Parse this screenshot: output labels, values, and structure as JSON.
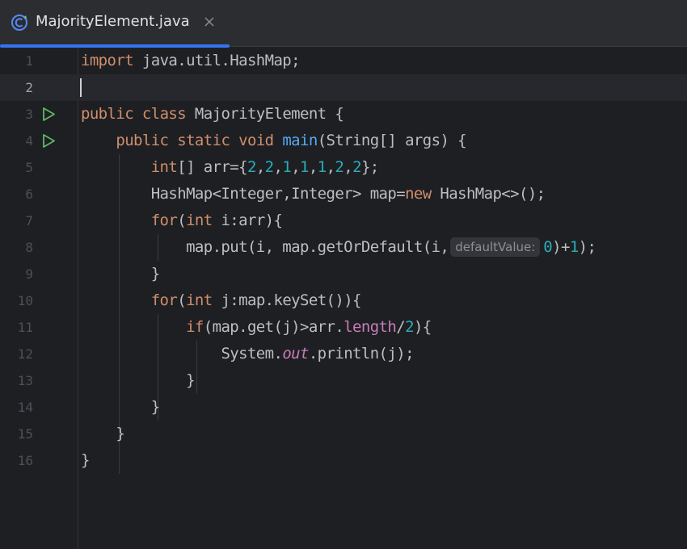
{
  "tab": {
    "title": "MajorityElement.java",
    "icon": "java-class-icon",
    "close_icon": "close-icon",
    "accent_color": "#3574f0"
  },
  "editor": {
    "current_line": 2,
    "line_numbers": [
      "1",
      "2",
      "3",
      "4",
      "5",
      "6",
      "7",
      "8",
      "9",
      "10",
      "11",
      "12",
      "13",
      "14",
      "15",
      "16"
    ],
    "run_icon_lines": [
      3,
      4
    ],
    "lines": {
      "l1": {
        "kw": "import",
        "rest": " java.util.HashMap;"
      },
      "l3": {
        "kw1": "public",
        "kw2": "class",
        "rest": " MajorityElement {"
      },
      "l4": {
        "indent": "    ",
        "kw1": "public",
        "kw2": "static",
        "kw3": "void",
        "fn": "main",
        "rest": "(String[] args) {"
      },
      "l5": {
        "indent": "        ",
        "kw": "int",
        "t1": "[] arr={",
        "n1": "2",
        "c1": ",",
        "n2": "2",
        "c2": ",",
        "n3": "1",
        "c3": ",",
        "n4": "1",
        "c4": ",",
        "n5": "1",
        "c5": ",",
        "n6": "2",
        "c6": ",",
        "n7": "2",
        "end": "};"
      },
      "l6": {
        "indent": "        ",
        "t1": "HashMap<Integer,Integer> map=",
        "kw": "new",
        "t2": " HashMap<>();"
      },
      "l7": {
        "indent": "        ",
        "kw1": "for",
        "t1": "(",
        "kw2": "int",
        "t2": " i:arr){"
      },
      "l8": {
        "indent": "            ",
        "t1": "map.put(i, map.getOrDefault(i,",
        "hint": "defaultValue:",
        "n1": "0",
        "t2": ")+",
        "n2": "1",
        "t3": ");"
      },
      "l9": {
        "text": "        }"
      },
      "l10": {
        "indent": "        ",
        "kw1": "for",
        "t1": "(",
        "kw2": "int",
        "t2": " j:map.keySet()){"
      },
      "l11": {
        "indent": "            ",
        "kw": "if",
        "t1": "(map.get(j)>arr.",
        "field": "length",
        "t2": "/",
        "n1": "2",
        "t3": "){"
      },
      "l12": {
        "indent": "                ",
        "t1": "System.",
        "sfield": "out",
        "t2": ".println(j);"
      },
      "l13": {
        "text": "            }"
      },
      "l14": {
        "text": "        }"
      },
      "l15": {
        "text": "    }"
      },
      "l16": {
        "text": "}"
      }
    }
  },
  "colors": {
    "keyword": "#cf8e6d",
    "number": "#2aacb8",
    "method_declaration": "#56a8f5",
    "field": "#c77dbb",
    "run_icon": "#5fb865"
  }
}
